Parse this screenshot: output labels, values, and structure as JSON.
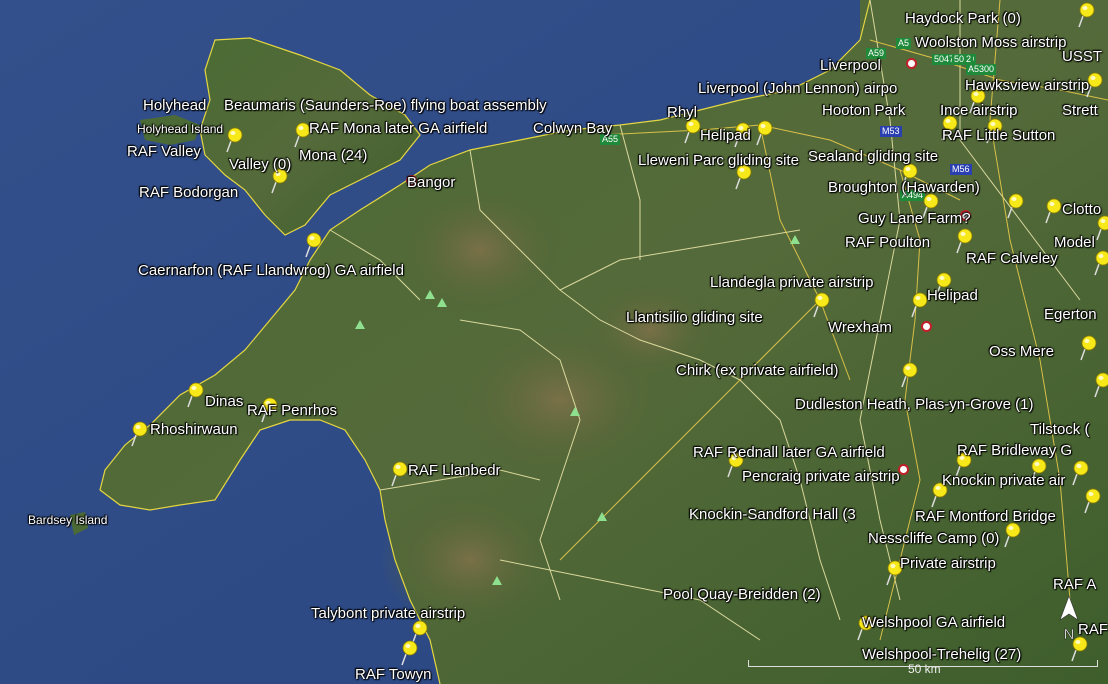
{
  "map": {
    "labels": [
      "Haydock Park (0)",
      "Woolston Moss airstrip",
      "Liverpool",
      "USST",
      "Liverpool (John Lennon) airpo",
      "Hawksview airstrip",
      "Rhyl",
      "Hooton Park",
      "Ince airstrip",
      "Strett",
      "Helipad",
      "RAF Little Sutton",
      "Lleweni Parc gliding site",
      "Sealand gliding site",
      "Broughton (Hawarden)",
      "Guy Lane Farm?",
      "Clotto",
      "RAF Poulton",
      "Model",
      "RAF Calveley",
      "Llandegla private airstrip",
      "Helipad",
      "Llantisilio gliding site",
      "Wrexham",
      "Egerton",
      "Oss Mere",
      "Chirk (ex private airfield)",
      "Dudleston Heath, Plas-yn-Grove (1)",
      "Tilstock (",
      "RAF Rednall later GA airfield",
      "RAF Bridleway G",
      "Pencraig private airstrip",
      "Knockin private air",
      "Knockin-Sandford Hall (3",
      "RAF Montford Bridge",
      "Nesscliffe Camp (0)",
      "Private airstrip",
      "RAF A",
      "Pool Quay-Breidden (2)",
      "Welshpool GA airfield",
      "RAF",
      "Welshpool-Trehelig (27)",
      "Holyhead",
      "Beaumaris (Saunders-Roe) flying boat assembly",
      "Holyhead Island",
      "RAF Mona later GA airfield",
      "Colwyn Bay",
      "RAF Valley",
      "Valley (0)",
      "Mona (24)",
      "Bangor",
      "RAF Bodorgan",
      "Caernarfon (RAF Llandwrog) GA airfield",
      "Dinas",
      "RAF Penrhos",
      "Rhoshirwaun",
      "RAF Llanbedr",
      "Bardsey Island",
      "Talybont private airstrip",
      "RAF Towyn"
    ],
    "road_shields": [
      "A59",
      "A5",
      "5047",
      "5080",
      "2",
      "A5300",
      "M53",
      "M56",
      "A494",
      "A55"
    ],
    "scale_text": "50 km",
    "compass_letter": "N"
  }
}
